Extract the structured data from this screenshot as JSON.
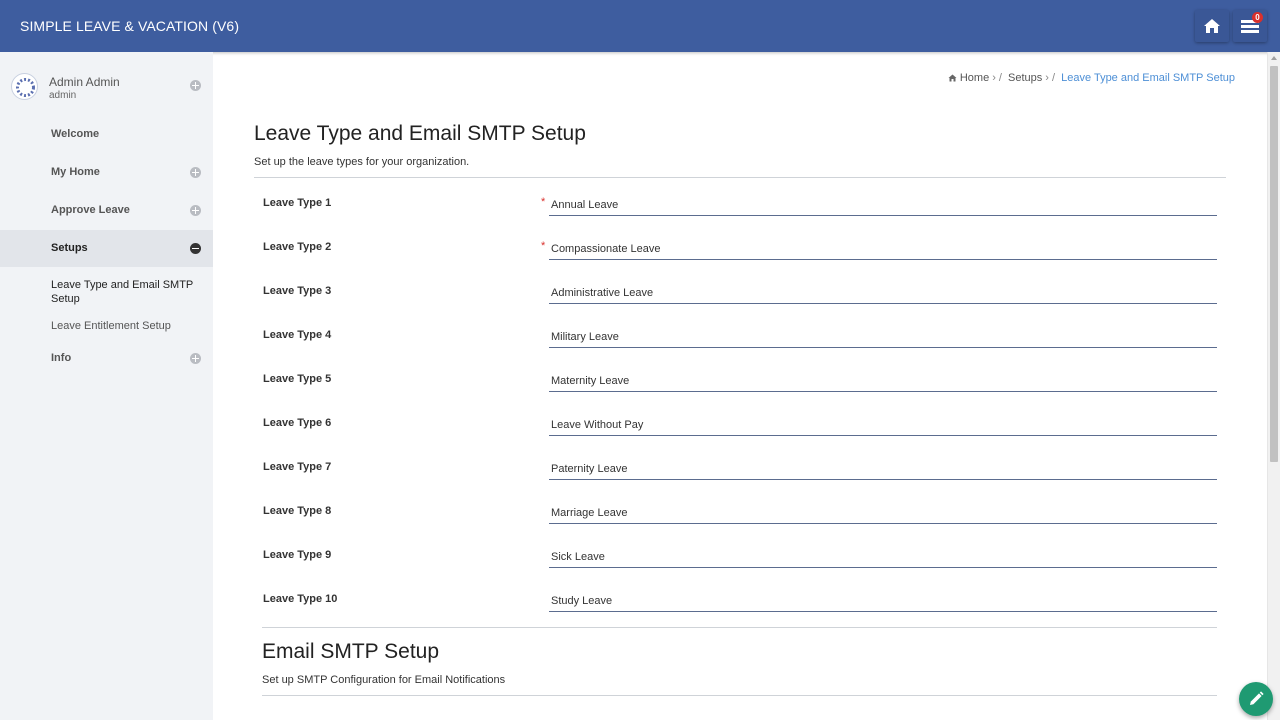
{
  "header": {
    "app_title": "SIMPLE LEAVE & VACATION (V6)",
    "notification_count": "0",
    "home_icon": "home-icon",
    "notification_icon": "list-icon"
  },
  "user": {
    "name": "Admin Admin",
    "role": "admin"
  },
  "sidebar": {
    "items": [
      {
        "label": "Welcome"
      },
      {
        "label": "My Home"
      },
      {
        "label": "Approve Leave"
      },
      {
        "label": "Setups"
      },
      {
        "label": "Info"
      }
    ],
    "setups_children": [
      {
        "label": "Leave Type and Email SMTP Setup"
      },
      {
        "label": "Leave Entitlement Setup"
      }
    ]
  },
  "breadcrumb": {
    "home": "Home",
    "setups": "Setups",
    "current": "Leave Type and Email SMTP Setup"
  },
  "page": {
    "title": "Leave Type and Email SMTP Setup",
    "subtitle": "Set up the leave types for your organization."
  },
  "leave_types": [
    {
      "label": "Leave Type 1",
      "value": "Annual Leave",
      "required": "*"
    },
    {
      "label": "Leave Type 2",
      "value": "Compassionate Leave",
      "required": "*"
    },
    {
      "label": "Leave Type 3",
      "value": "Administrative Leave"
    },
    {
      "label": "Leave Type 4",
      "value": "Military Leave"
    },
    {
      "label": "Leave Type 5",
      "value": "Maternity Leave"
    },
    {
      "label": "Leave Type 6",
      "value": "Leave Without Pay"
    },
    {
      "label": "Leave Type 7",
      "value": "Paternity Leave"
    },
    {
      "label": "Leave Type 8",
      "value": "Marriage Leave"
    },
    {
      "label": "Leave Type 9",
      "value": "Sick Leave"
    },
    {
      "label": "Leave Type 10",
      "value": "Study Leave"
    }
  ],
  "smtp": {
    "title": "Email SMTP Setup",
    "subtitle": "Set up SMTP Configuration for Email Notifications"
  },
  "colors": {
    "topbar": "#3e5d9f",
    "accent": "#4d8fd6",
    "fab": "#1f9a72",
    "required": "#d9302c"
  }
}
